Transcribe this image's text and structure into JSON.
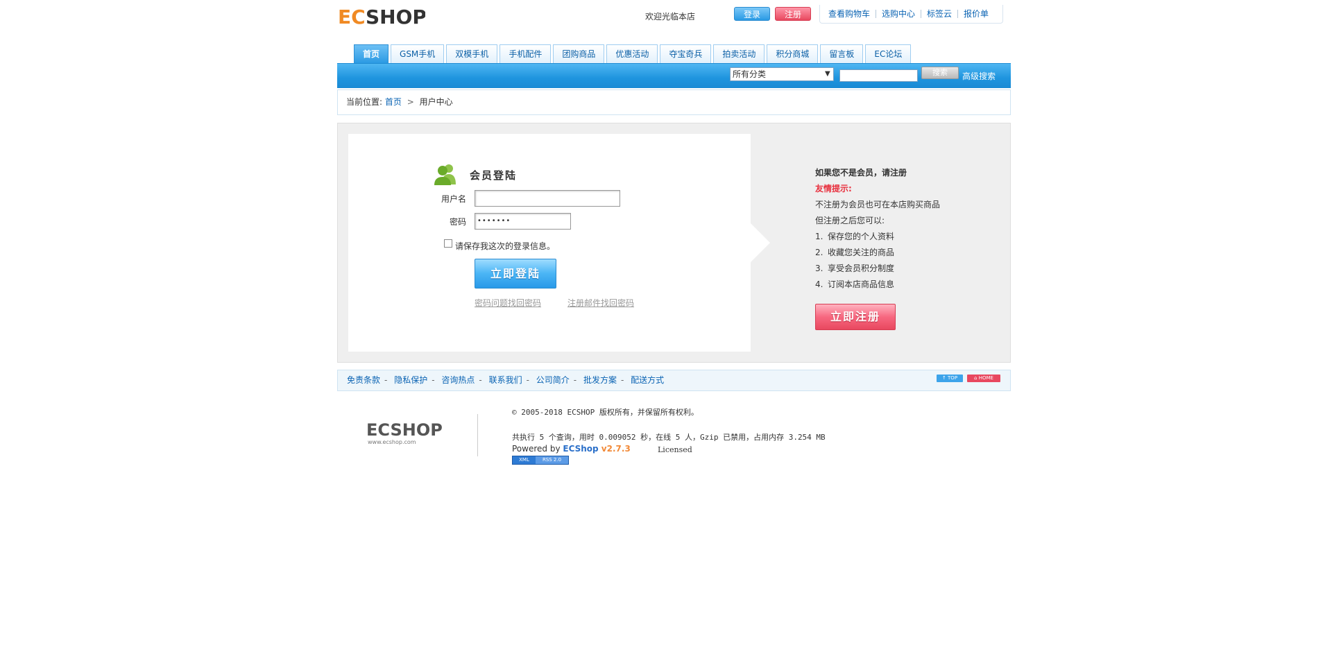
{
  "header": {
    "logo_text": "ECSHOP",
    "welcome": "欢迎光临本店",
    "login_label": "登录",
    "register_label": "注册",
    "top_links": [
      "查看购物车",
      "选购中心",
      "标签云",
      "报价单"
    ]
  },
  "nav": {
    "tabs": [
      "首页",
      "GSM手机",
      "双模手机",
      "手机配件",
      "团购商品",
      "优惠活动",
      "夺宝奇兵",
      "拍卖活动",
      "积分商城",
      "留言板",
      "EC论坛"
    ],
    "active_index": 0
  },
  "search": {
    "category_selected": "所有分类",
    "button_label": "搜索",
    "advanced_label": "高级搜索"
  },
  "breadcrumb": {
    "prefix": "当前位置:",
    "home": "首页",
    "sep": ">",
    "current": "用户中心"
  },
  "login": {
    "title": "会员登陆",
    "username_label": "用户名",
    "username_value": "",
    "password_label": "密码",
    "password_masked": "•••••••",
    "remember_label": "请保存我这次的登录信息。",
    "remember_checked": false,
    "submit_label": "立即登陆",
    "recover_question": "密码问题找回密码",
    "recover_email": "注册邮件找回密码"
  },
  "register_info": {
    "question": "如果您不是会员，请注册",
    "tip_title": "友情提示:",
    "line1": "不注册为会员也可在本店购买商品",
    "line2": "但注册之后您可以:",
    "items": [
      {
        "n": "1.",
        "text": "保存您的个人资料"
      },
      {
        "n": "2.",
        "text": "收藏您关注的商品"
      },
      {
        "n": "3.",
        "text": "享受会员积分制度"
      },
      {
        "n": "4.",
        "text": "订阅本店商品信息"
      }
    ],
    "submit_label": "立即注册"
  },
  "footer": {
    "links": [
      "免责条款",
      "隐私保护",
      "咨询热点",
      "联系我们",
      "公司简介",
      "批发方案",
      "配送方式"
    ],
    "top_badge": "↑ TOP",
    "home_badge": "⌂ HOME",
    "logo_text": "ECSHOP",
    "logo_url_text": "www.ecshop.com",
    "copyright": "© 2005-2018 ECSHOP 版权所有，并保留所有权利。",
    "stats": "共执行 5 个查询，用时 0.009052 秒，在线 5 人，Gzip 已禁用，占用内存 3.254 MB",
    "powered_prefix": "Powered by ",
    "powered_brand": "ECShop",
    "powered_version": " v2.7.3",
    "licensed": "Licensed",
    "xml_badge": "XML",
    "rss_badge": "RSS 2.0"
  },
  "colors": {
    "nav_blue": "#2b9ae3",
    "login_blue": "#4ab5f5",
    "register_pink": "#f76880",
    "tip_red": "#e8303e",
    "link_blue": "#0a63b3"
  }
}
